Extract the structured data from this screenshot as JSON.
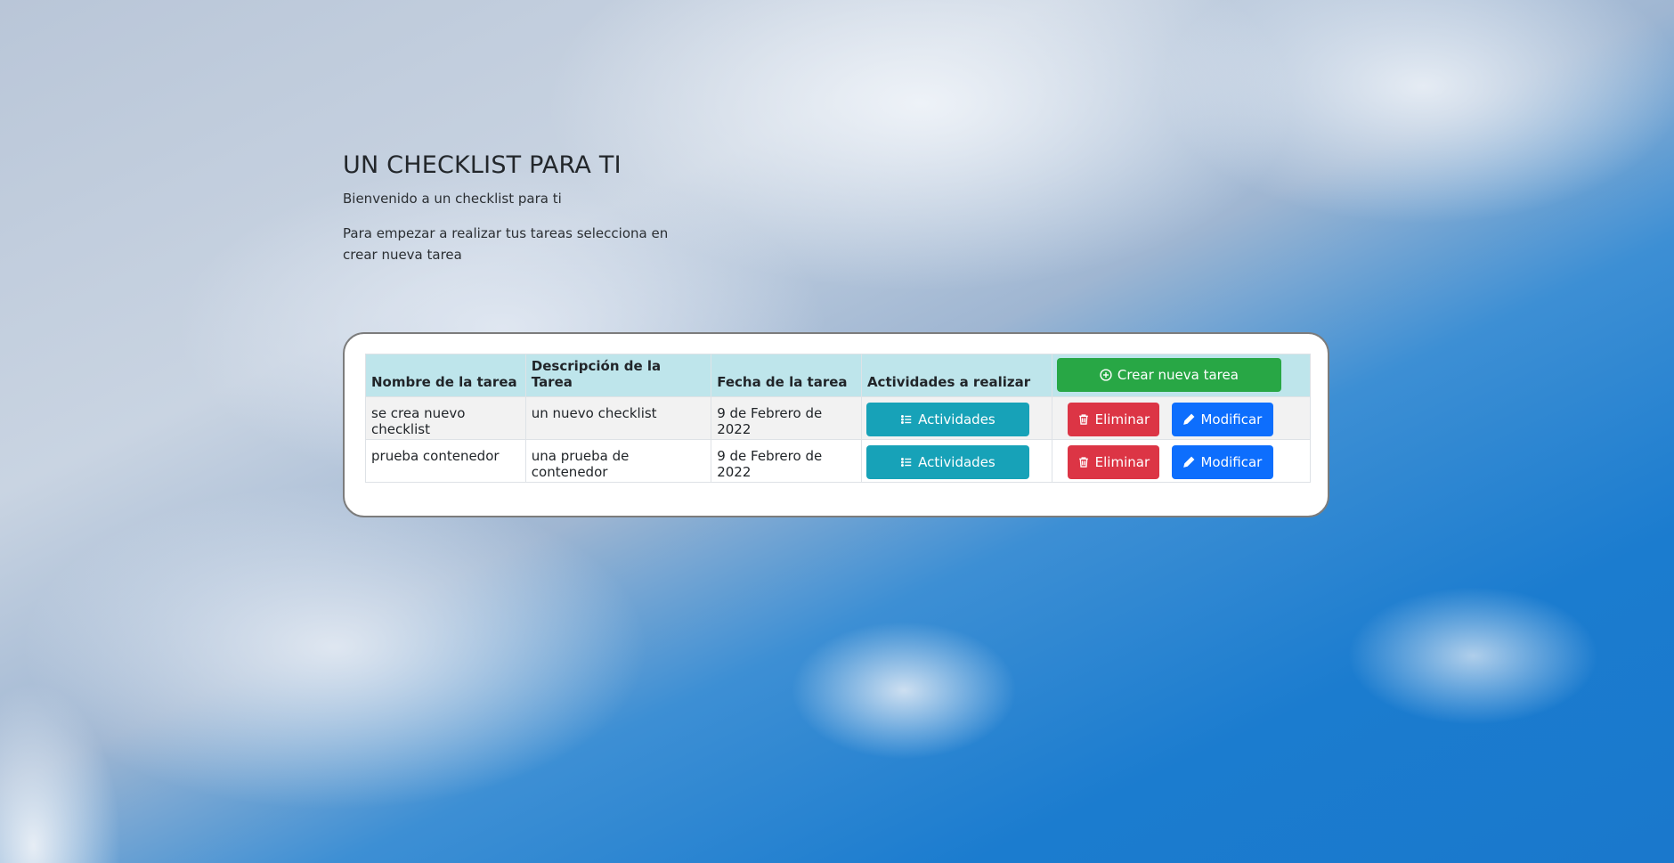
{
  "hero": {
    "title": "UN CHECKLIST PARA TI",
    "welcome": "Bienvenido a un checklist para ti",
    "instructions": "Para empezar a realizar tus tareas selecciona en crear nueva tarea"
  },
  "table": {
    "headers": {
      "name": "Nombre de la tarea",
      "description": "Descripción de la Tarea",
      "date": "Fecha de la tarea",
      "activities": "Actividades a realizar"
    },
    "create_button": "Crear nueva tarea",
    "rows": [
      {
        "name": "se crea nuevo checklist",
        "description": "un nuevo checklist",
        "date": "9 de Febrero de 2022",
        "activities_button": "Actividades",
        "delete_button": "Eliminar",
        "edit_button": "Modificar"
      },
      {
        "name": "prueba contenedor",
        "description": "una prueba de contenedor",
        "date": "9 de Febrero de 2022",
        "activities_button": "Actividades",
        "delete_button": "Eliminar",
        "edit_button": "Modificar"
      }
    ]
  },
  "colors": {
    "create": "#28a745",
    "activities": "#17a2b8",
    "delete": "#dc3545",
    "edit": "#0d6efd",
    "header_bg": "#bee5eb"
  },
  "icons": {
    "create": "plus-circle-icon",
    "activities": "list-icon",
    "delete": "trash-icon",
    "edit": "pencil-icon"
  }
}
